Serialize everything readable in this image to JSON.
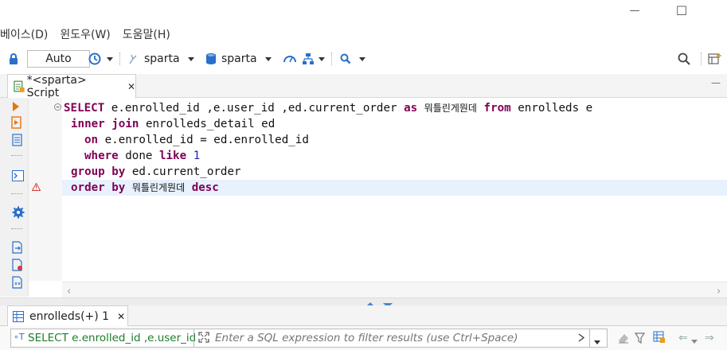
{
  "window": {
    "minimize_glyph": "—",
    "maximize_glyph": "☐"
  },
  "menu": [
    "베이스(D)",
    "윈도우(W)",
    "도움말(H)"
  ],
  "toolbar": {
    "commit_mode": "Auto",
    "connection": "sparta",
    "schema": "sparta"
  },
  "editor": {
    "tab_title": "*<sparta> Script",
    "close_glyph": "✕",
    "tab_min_glyph": "—"
  },
  "sql": {
    "l1": {
      "select": "SELECT",
      "cols": " e.enrolled_id ,e.user_id ,ed.current_order ",
      "as": "as",
      "alias": "뭐틀린게뭔데",
      "from": "from",
      "table": " enrolleds e"
    },
    "l2": {
      "kw": "inner join",
      "rest": " enrolleds_detail ed"
    },
    "l3": {
      "kw": "on",
      "rest": " e.enrolled_id = ed.enrolled_id"
    },
    "l4": {
      "kw": "where",
      "rest": " done ",
      "like": "like",
      "num": "1"
    },
    "l5": {
      "kw": "group by",
      "rest": " ed.current_order"
    },
    "l6": {
      "kw": "order by",
      "alias": "뭐틀린게뭔데",
      "desc": "desc"
    }
  },
  "results": {
    "tab_title": "enrolleds(+) 1",
    "close_glyph": "✕",
    "query_preview": "SELECT e.enrolled_id ,e.user_id",
    "filter_placeholder": "Enter a SQL expression to filter results (use Ctrl+Space)"
  },
  "colors": {
    "keyword": "#7f0055",
    "number": "#2020c0",
    "current_line": "#e8f2fe",
    "link_green": "#1d7c2a"
  }
}
